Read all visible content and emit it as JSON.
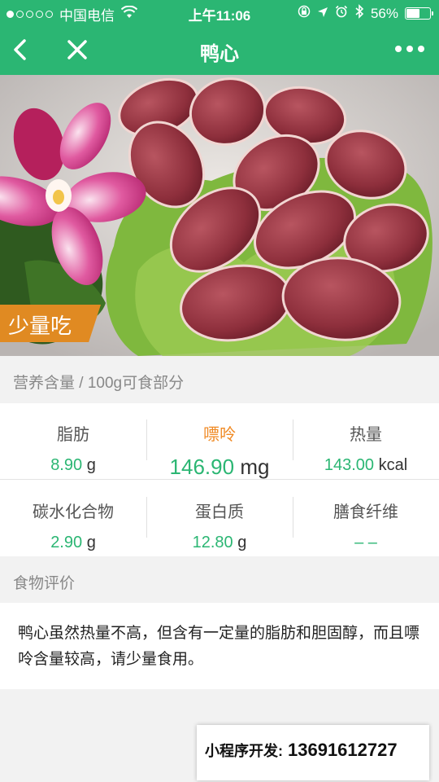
{
  "status_bar": {
    "carrier": "中国电信",
    "time": "上午11:06",
    "battery_text": "56%",
    "battery_level": 0.56
  },
  "nav": {
    "title": "鸭心",
    "back_icon": "chevron-left-icon",
    "close_icon": "close-icon",
    "more_icon": "more-dots-icon"
  },
  "hero": {
    "tag": "少量吃",
    "tag_color": "#e08a22"
  },
  "nutrition": {
    "section_title": "营养含量 / 100g可食部分",
    "items": [
      {
        "label": "脂肪",
        "value": "8.90",
        "unit": "g"
      },
      {
        "label": "嘌呤",
        "value": "146.90",
        "unit": "mg"
      },
      {
        "label": "热量",
        "value": "143.00",
        "unit": "kcal"
      },
      {
        "label": "碳水化合物",
        "value": "2.90",
        "unit": "g"
      },
      {
        "label": "蛋白质",
        "value": "12.80",
        "unit": "g"
      },
      {
        "label": "膳食纤维",
        "value": "– –",
        "unit": ""
      }
    ]
  },
  "evaluation": {
    "section_title": "食物评价",
    "text": "鸭心虽然热量不高，但含有一定量的脂肪和胆固醇，而且嘌呤含量较高，请少量食用。"
  },
  "developer": {
    "label": "小程序开发:",
    "phone": "13691612727"
  },
  "colors": {
    "brand_green": "#2bb673",
    "highlight_orange": "#f08a24"
  }
}
